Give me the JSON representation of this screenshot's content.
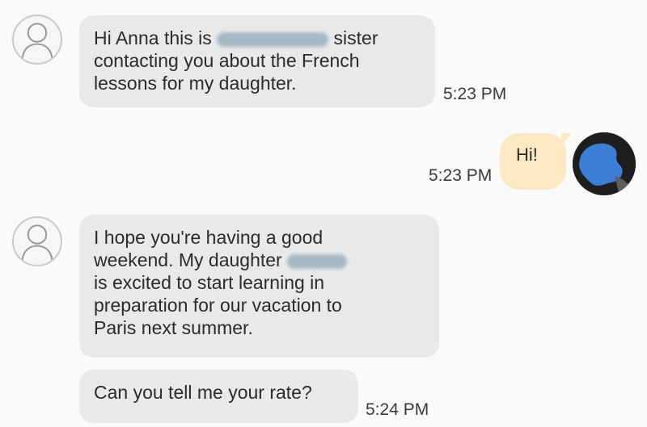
{
  "messages": [
    {
      "lines": [
        "Hi Anna this is",
        "sister",
        "contacting you about the French",
        "lessons for my daughter."
      ],
      "time": "5:23 PM",
      "redacted": true
    },
    {
      "text": "Hi!",
      "time": "5:23 PM",
      "outgoing": true
    },
    {
      "lines": [
        "I hope you're having a good",
        "weekend. My daughter",
        "is excited to start learning  in",
        "preparation for our vacation to",
        "Paris next summer."
      ],
      "redacted": true
    },
    {
      "text": "Can you tell me your rate?",
      "time": "5:24 PM"
    }
  ],
  "icons": {
    "contact_avatar": "person-outline-icon",
    "my_avatar": "profile-photo"
  },
  "colors": {
    "incoming_bubble": "#e9e9e9",
    "outgoing_bubble": "#fbe9c4",
    "redaction": "#9bb0bd",
    "background": "#fafafa"
  }
}
